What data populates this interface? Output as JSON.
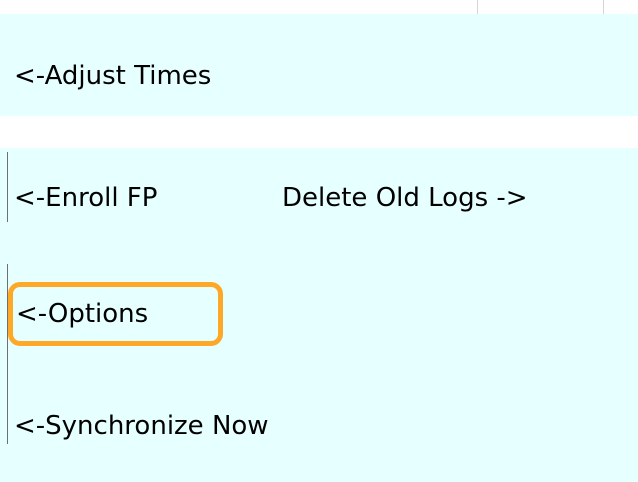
{
  "colors": {
    "panel_bg": "#e6ffff",
    "highlight": "#ffa726"
  },
  "menu": {
    "adjust_times": "<-Adjust Times",
    "enroll_fp": "<-Enroll FP",
    "delete_old_logs": "Delete Old Logs ->",
    "options": "<-Options",
    "synchronize_now": "<-Synchronize Now"
  }
}
